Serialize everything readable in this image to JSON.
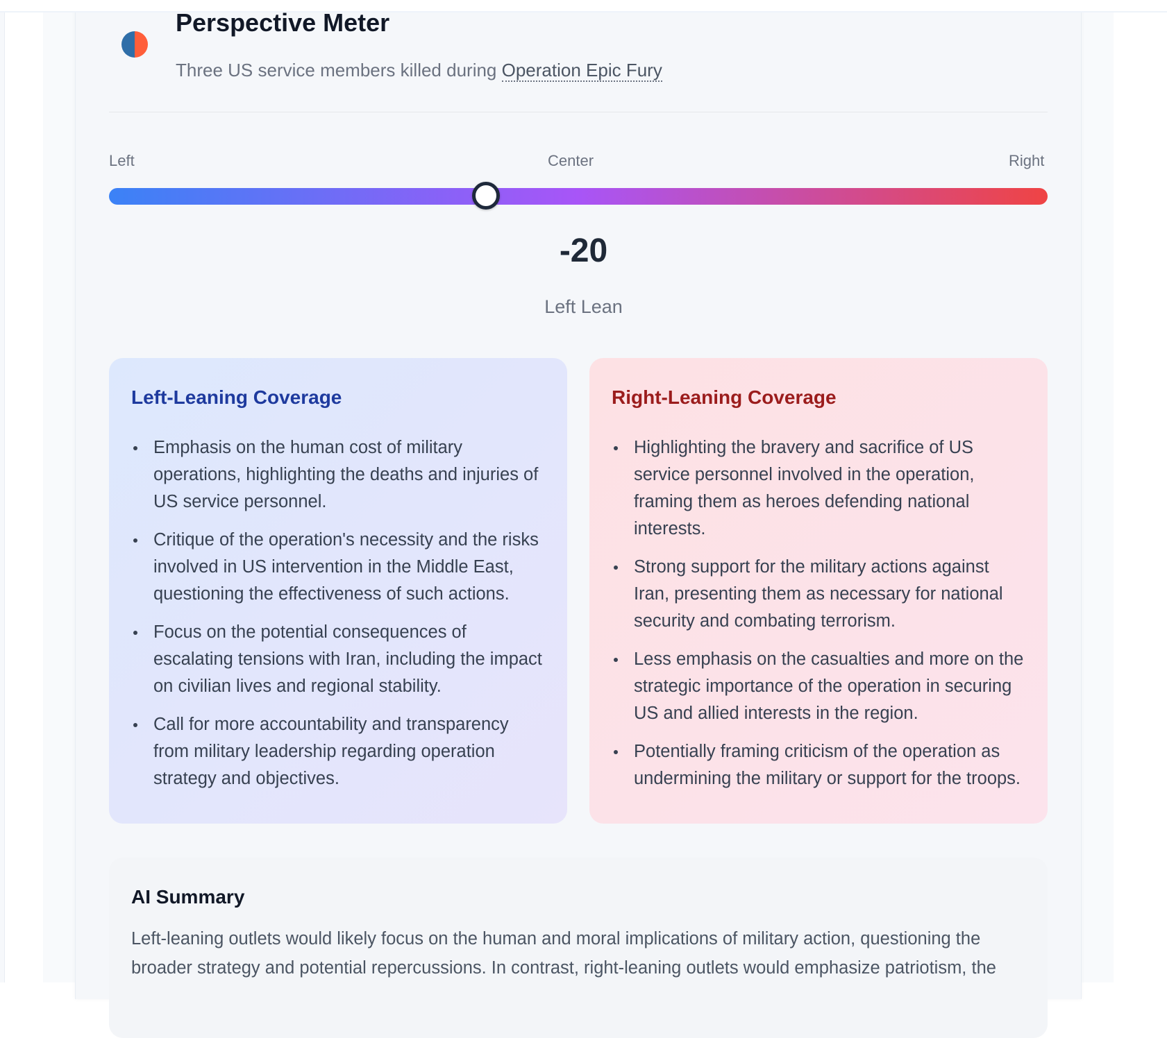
{
  "perspective_meter": {
    "title": "Perspective Meter",
    "subtitle_prefix": "Three US service members killed during ",
    "topic_link": "Operation Epic Fury",
    "scale": {
      "left_label": "Left",
      "center_label": "Center",
      "right_label": "Right",
      "min": -100,
      "max": 100
    },
    "score": -20,
    "score_display": "-20",
    "lean_label": "Left Lean"
  },
  "left_coverage": {
    "title": "Left-Leaning Coverage",
    "items": [
      "Emphasis on the human cost of military operations, highlighting the deaths and injuries of US service personnel.",
      "Critique of the operation's necessity and the risks involved in US intervention in the Middle East, questioning the effectiveness of such actions.",
      "Focus on the potential consequences of escalating tensions with Iran, including the impact on civilian lives and regional stability.",
      "Call for more accountability and transparency from military leadership regarding operation strategy and objectives."
    ]
  },
  "right_coverage": {
    "title": "Right-Leaning Coverage",
    "items": [
      "Highlighting the bravery and sacrifice of US service personnel involved in the operation, framing them as heroes defending national interests.",
      "Strong support for the military actions against Iran, presenting them as necessary for national security and combating terrorism.",
      "Less emphasis on the casualties and more on the strategic importance of the operation in securing US and allied interests in the region.",
      "Potentially framing criticism of the operation as undermining the military or support for the troops."
    ]
  },
  "ai_summary": {
    "title": "AI Summary",
    "text": "Left-leaning outlets would likely focus on the human and moral implications of military action, questioning the broader strategy and potential repercussions. In contrast, right-leaning outlets would emphasize patriotism, the"
  },
  "colors": {
    "meter_left": "#3b82f6",
    "meter_center": "#a855f7",
    "meter_right": "#ef4444",
    "left_heading": "#1e3a9e",
    "right_heading": "#9b1c1c",
    "icon_blue": "#2f6ea8",
    "icon_orange": "#ff5e3a"
  }
}
